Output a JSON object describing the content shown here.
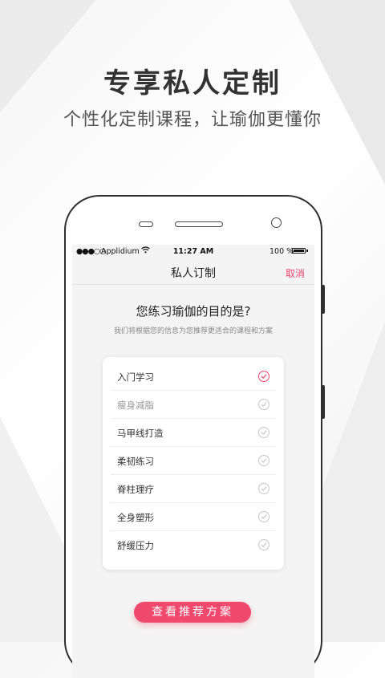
{
  "promo": {
    "headline": "专享私人定制",
    "subline": "个性化定制课程，让瑜伽更懂你"
  },
  "status_bar": {
    "signal": "●●●○○",
    "carrier": "Applidium",
    "wifi_icon": "wifi-icon",
    "time": "11:27 AM",
    "battery_pct": "100 %"
  },
  "navbar": {
    "title": "私人订制",
    "cancel": "取消"
  },
  "survey": {
    "question": "您练习瑜伽的目的是?",
    "hint": "我们将根据您的信息为您推荐更适合的课程和方案",
    "options": [
      {
        "label": "入门学习",
        "selected": true
      },
      {
        "label": "瘦身减脂",
        "selected": false
      },
      {
        "label": "马甲线打造",
        "selected": false
      },
      {
        "label": "柔韧练习",
        "selected": false
      },
      {
        "label": "脊柱理疗",
        "selected": false
      },
      {
        "label": "全身塑形",
        "selected": false
      },
      {
        "label": "舒缓压力",
        "selected": false
      }
    ],
    "cta": "查看推荐方案"
  },
  "colors": {
    "accent": "#ef4a6e",
    "cancel": "#e8456e",
    "selected_check": "#e8456e"
  }
}
